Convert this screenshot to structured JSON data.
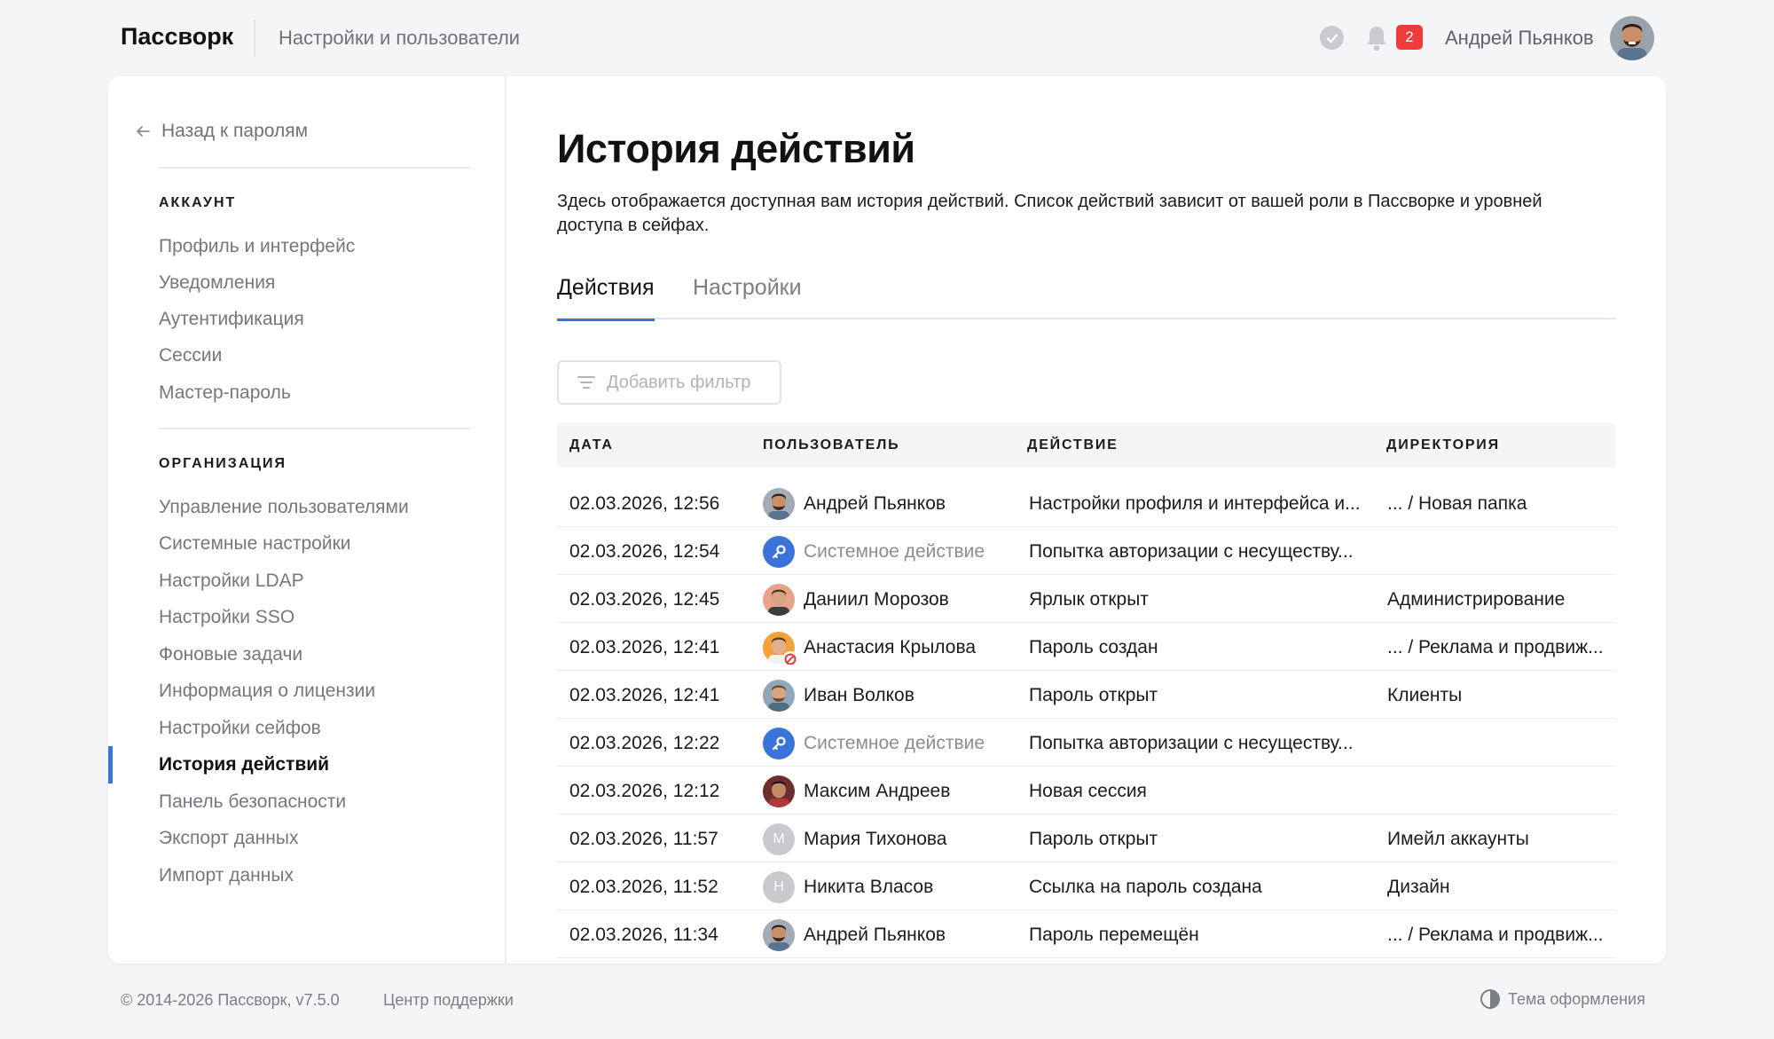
{
  "header": {
    "brand": "Пассворк",
    "section": "Настройки и пользователи",
    "notifications_count": "2",
    "user_name": "Андрей Пьянков"
  },
  "sidebar": {
    "back_label": "Назад к паролям",
    "groups": [
      {
        "title": "АККАУНТ",
        "items": [
          "Профиль и интерфейс",
          "Уведомления",
          "Аутентификация",
          "Сессии",
          "Мастер-пароль"
        ]
      },
      {
        "title": "ОРГАНИЗАЦИЯ",
        "items": [
          "Управление пользователями",
          "Системные настройки",
          "Настройки LDAP",
          "Настройки SSO",
          "Фоновые задачи",
          "Информация о лицензии",
          "Настройки сейфов",
          "История действий",
          "Панель безопасности",
          "Экспорт данных",
          "Импорт данных"
        ]
      }
    ],
    "active_item": "История действий"
  },
  "main": {
    "title": "История действий",
    "description": "Здесь отображается доступная вам история действий. Список действий зависит от вашей роли в Пассворке и уровней доступа в сейфах.",
    "tabs": [
      {
        "label": "Действия",
        "active": true
      },
      {
        "label": "Настройки",
        "active": false
      }
    ],
    "filter_label": "Добавить фильтр"
  },
  "table": {
    "columns": [
      "ДАТА",
      "ПОЛЬЗОВАТЕЛЬ",
      "ДЕЙСТВИЕ",
      "ДИРЕКТОРИЯ"
    ],
    "rows": [
      {
        "date": "02.03.2026, 12:56",
        "user": "Андрей Пьянков",
        "avatar": "photo-man-beard",
        "action": "Настройки профиля и интерфейса и...",
        "dir": "... / Новая папка"
      },
      {
        "date": "02.03.2026, 12:54",
        "user": "Системное действие",
        "avatar": "system-key-icon",
        "action": "Попытка авторизации с несуществу...",
        "dir": ""
      },
      {
        "date": "02.03.2026, 12:45",
        "user": "Даниил Морозов",
        "avatar": "photo-man-short-hair",
        "action": "Ярлык открыт",
        "dir": "Администрирование"
      },
      {
        "date": "02.03.2026, 12:41",
        "user": "Анастасия Крылова",
        "avatar": "photo-woman-blocked",
        "action": "Пароль создан",
        "dir": "... / Реклама и продвиж..."
      },
      {
        "date": "02.03.2026, 12:41",
        "user": "Иван Волков",
        "avatar": "photo-man-beard-light",
        "action": "Пароль открыт",
        "dir": "Клиенты"
      },
      {
        "date": "02.03.2026, 12:22",
        "user": "Системное действие",
        "avatar": "system-key-icon",
        "action": "Попытка авторизации с несуществу...",
        "dir": ""
      },
      {
        "date": "02.03.2026, 12:12",
        "user": "Максим Андреев",
        "avatar": "photo-man-dark",
        "action": "Новая сессия",
        "dir": ""
      },
      {
        "date": "02.03.2026, 11:57",
        "user": "Мария Тихонова",
        "avatar": "letter-М",
        "action": "Пароль открыт",
        "dir": "Имейл аккаунты"
      },
      {
        "date": "02.03.2026, 11:52",
        "user": "Никита Власов",
        "avatar": "letter-Н",
        "action": "Ссылка на пароль создана",
        "dir": "Дизайн"
      },
      {
        "date": "02.03.2026, 11:34",
        "user": "Андрей Пьянков",
        "avatar": "photo-man-beard",
        "action": "Пароль перемещён",
        "dir": "... / Реклама и продвиж..."
      }
    ]
  },
  "footer": {
    "copyright": "© 2014-2026 Пассворк, v7.5.0",
    "support": "Центр поддержки",
    "theme": "Тема оформления"
  },
  "colors": {
    "accent": "#3a74d9",
    "badge": "#ee3b3b",
    "background": "#f4f5f7"
  }
}
